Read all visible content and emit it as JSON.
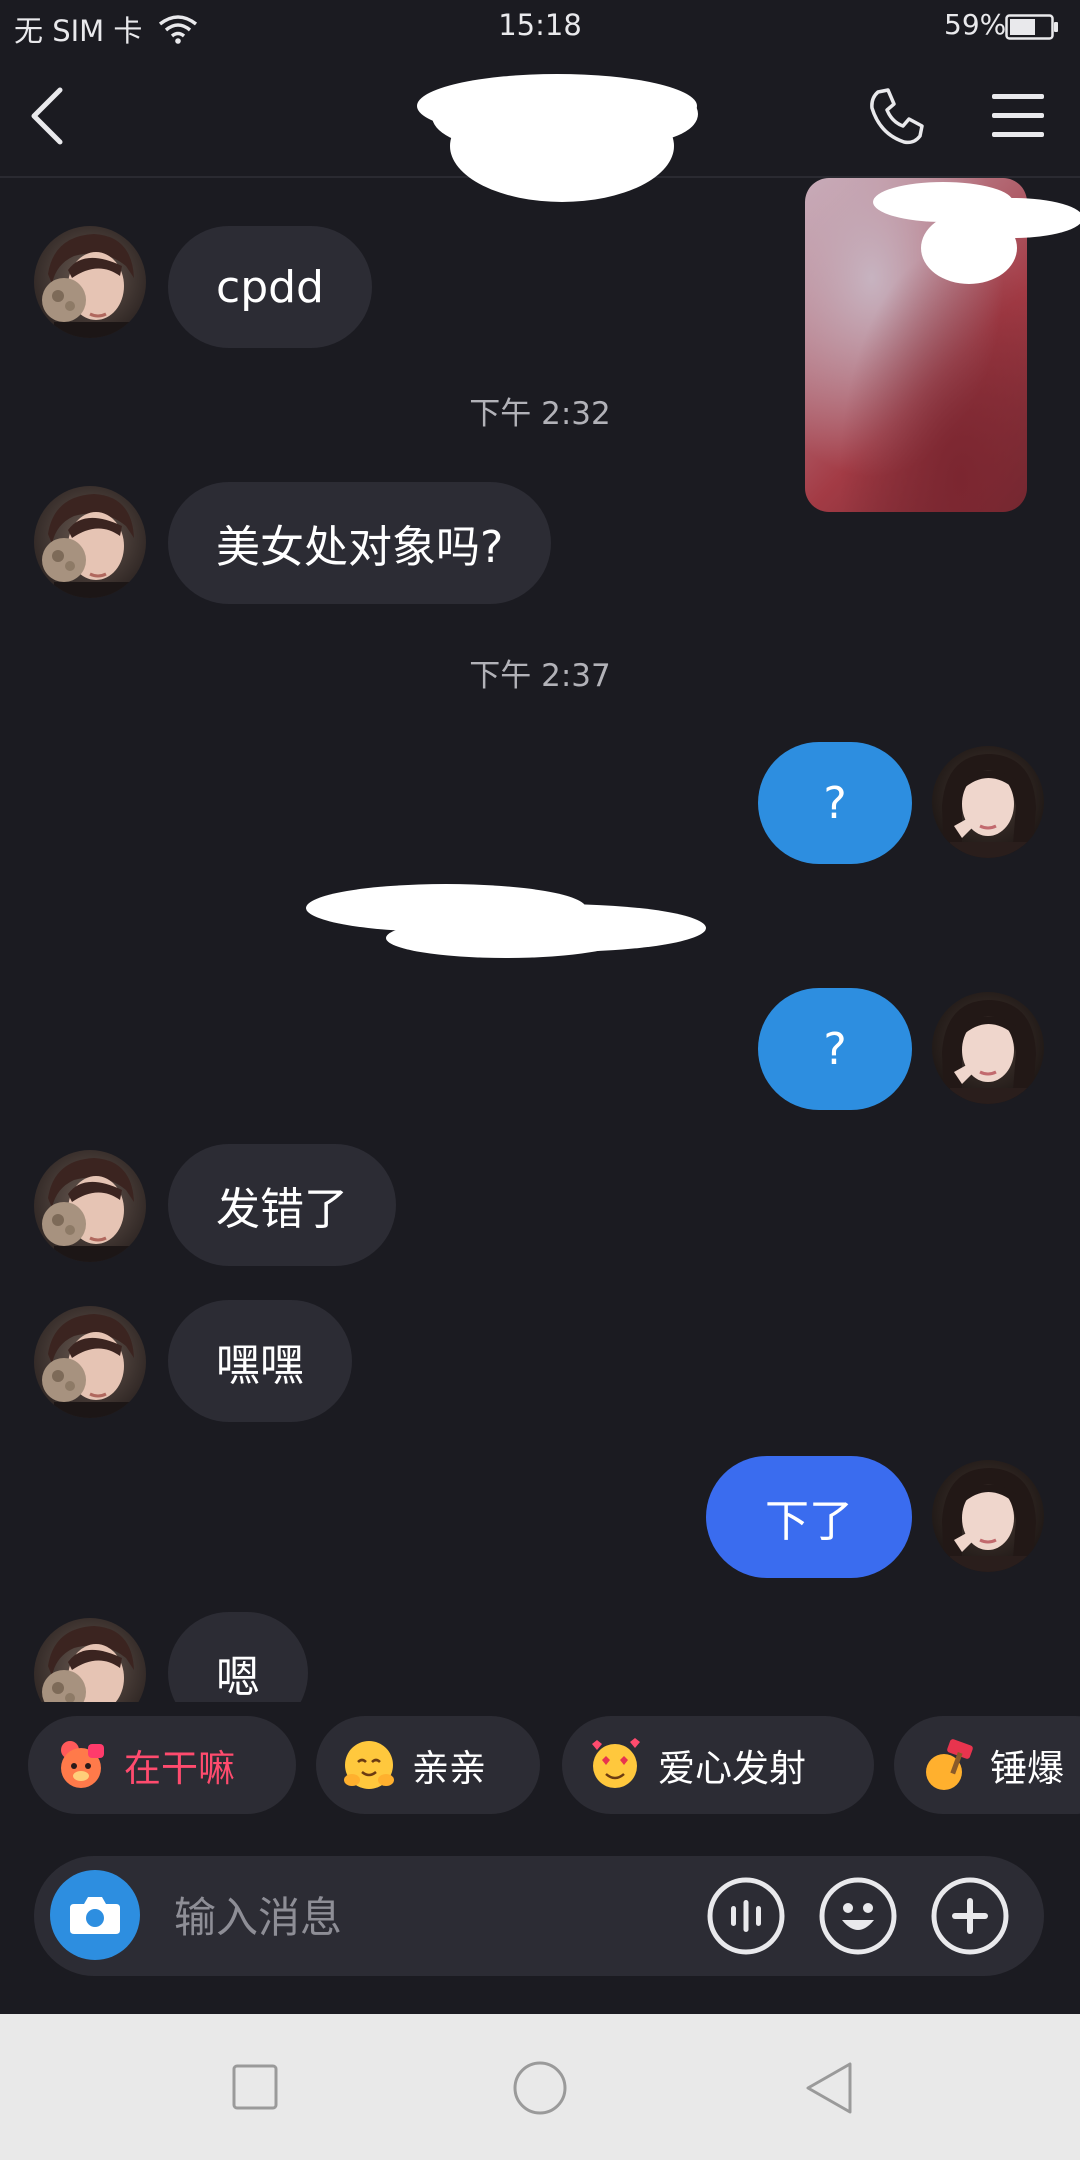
{
  "status_bar": {
    "carrier": "无 SIM 卡",
    "time": "15:18",
    "battery": "59%"
  },
  "header": {
    "icons": [
      "back-arrow-icon",
      "phone-icon",
      "menu-icon"
    ]
  },
  "messages": [
    {
      "from": "them",
      "text": "cpdd"
    },
    {
      "type": "time",
      "text": "下午 2:32"
    },
    {
      "from": "them",
      "text": "美女处对象吗?"
    },
    {
      "type": "time",
      "text": "下午 2:37"
    },
    {
      "from": "me",
      "text": "?"
    },
    {
      "from": "me",
      "text": "?"
    },
    {
      "from": "them",
      "text": "发错了"
    },
    {
      "from": "them",
      "text": "嘿嘿"
    },
    {
      "from": "me",
      "text": "下了"
    },
    {
      "from": "them",
      "text": "嗯"
    }
  ],
  "quick_replies": [
    {
      "label": "在干嘛",
      "icon": "bear-icon",
      "color": "#ff4b6e"
    },
    {
      "label": "亲亲",
      "icon": "hug-face-icon",
      "color": "#ffffff"
    },
    {
      "label": "爱心发射",
      "icon": "heart-eyes-face-icon",
      "color": "#ffffff"
    },
    {
      "label": "锤爆",
      "icon": "hammer-icon",
      "color": "#ffffff"
    }
  ],
  "input": {
    "placeholder": "输入消息",
    "buttons": [
      "camera-icon",
      "voice-icon",
      "emoji-icon",
      "plus-icon"
    ]
  },
  "colors": {
    "background": "#1b1b21",
    "incoming_bubble": "#2c2c34",
    "outgoing_bubble": "#2d8ee0",
    "outgoing_bubble_alt": "#3a6cef",
    "nav_bar": "#e9e9e9"
  }
}
